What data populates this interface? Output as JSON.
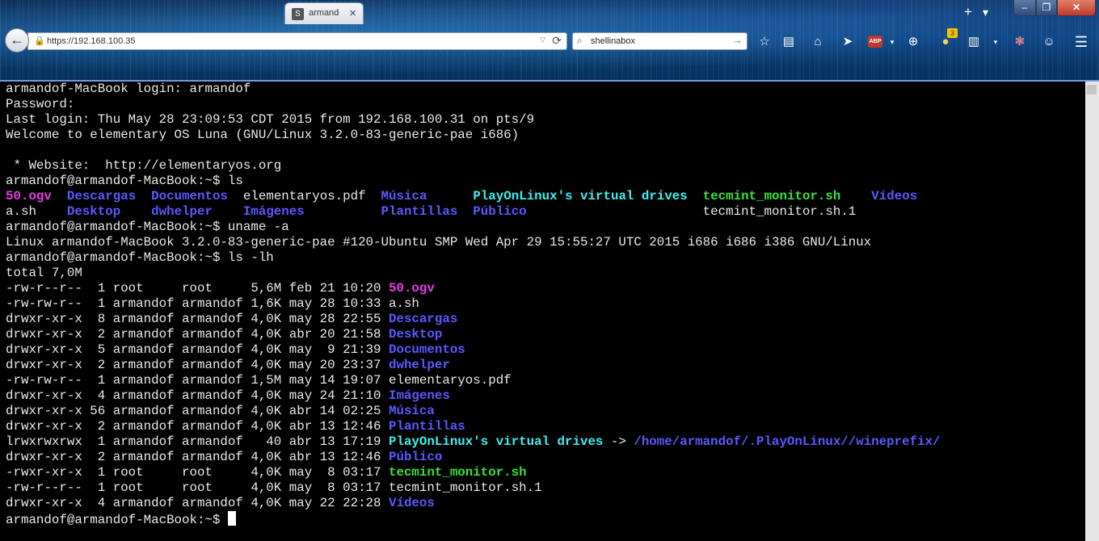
{
  "browser": {
    "tab_title": "armandof",
    "tab_close": "×",
    "new_tab": "+",
    "tab_list": "▾",
    "window_controls": {
      "minimize": "–",
      "maximize": "❐",
      "close": "✕"
    },
    "url": "https://192.168.100.35",
    "search": {
      "value": "shellinabox"
    },
    "toolbar_icons": [
      "bookmark-star-icon",
      "reading-list-icon",
      "home-icon",
      "send-icon",
      "adblock-icon",
      "globe-icon",
      "colorful-extension-icon",
      "clipboard-icon",
      "dropdown-icon",
      "cluster-icon",
      "smiley-icon",
      "menu-icon"
    ],
    "extension_badge": "3",
    "abp_label": "ABP"
  },
  "terminal": {
    "colors": {
      "magenta": "#e83ce8",
      "blue": "#5959ff",
      "cyan": "#3ef0f0",
      "green": "#35e43a",
      "text": "#e9e9e9"
    },
    "lines": [
      {
        "t": "armandof-MacBook login: armandof"
      },
      {
        "t": "Password:"
      },
      {
        "t": "Last login: Thu May 28 23:09:53 CDT 2015 from 192.168.100.31 on pts/9"
      },
      {
        "t": "Welcome to elementary OS Luna (GNU/Linux 3.2.0-83-generic-pae i686)"
      },
      {
        "t": ""
      },
      {
        "t": " * Website:  http://elementaryos.org"
      },
      {
        "t": "armandof@armandof-MacBook:~$ ls"
      },
      {
        "segs": [
          [
            "mag",
            "50.ogv"
          ],
          [
            "",
            "  "
          ],
          [
            "blue",
            "Descargas"
          ],
          [
            "",
            "  "
          ],
          [
            "blue",
            "Documentos"
          ],
          [
            "",
            "  elementaryos.pdf  "
          ],
          [
            "blue",
            "Música"
          ],
          [
            "",
            "      "
          ],
          [
            "cyan",
            "PlayOnLinux's virtual drives"
          ],
          [
            "",
            "  "
          ],
          [
            "green",
            "tecmint_monitor.sh"
          ],
          [
            "",
            "    "
          ],
          [
            "blue",
            "Vídeos"
          ]
        ]
      },
      {
        "segs": [
          [
            "",
            "a.sh    "
          ],
          [
            "blue",
            "Desktop"
          ],
          [
            "",
            "    "
          ],
          [
            "blue",
            "dwhelper"
          ],
          [
            "",
            "    "
          ],
          [
            "blue",
            "Imágenes"
          ],
          [
            "",
            "          "
          ],
          [
            "blue",
            "Plantillas"
          ],
          [
            "",
            "  "
          ],
          [
            "blue",
            "Público"
          ],
          [
            "",
            "                       tecmint_monitor.sh.1"
          ]
        ]
      },
      {
        "t": "armandof@armandof-MacBook:~$ uname -a"
      },
      {
        "t": "Linux armandof-MacBook 3.2.0-83-generic-pae #120-Ubuntu SMP Wed Apr 29 15:55:27 UTC 2015 i686 i686 i386 GNU/Linux"
      },
      {
        "t": "armandof@armandof-MacBook:~$ ls -lh"
      },
      {
        "t": "total 7,0M"
      },
      {
        "segs": [
          [
            "",
            "-rw-r--r--  1 root     root     5,6M feb 21 10:20 "
          ],
          [
            "mag",
            "50.ogv"
          ]
        ]
      },
      {
        "t": "-rw-rw-r--  1 armandof armandof 1,6K may 28 10:33 a.sh"
      },
      {
        "segs": [
          [
            "",
            "drwxr-xr-x  8 armandof armandof 4,0K may 28 22:55 "
          ],
          [
            "blue",
            "Descargas"
          ]
        ]
      },
      {
        "segs": [
          [
            "",
            "drwxr-xr-x  2 armandof armandof 4,0K abr 20 21:58 "
          ],
          [
            "blue",
            "Desktop"
          ]
        ]
      },
      {
        "segs": [
          [
            "",
            "drwxr-xr-x  5 armandof armandof 4,0K may  9 21:39 "
          ],
          [
            "blue",
            "Documentos"
          ]
        ]
      },
      {
        "segs": [
          [
            "",
            "drwxr-xr-x  2 armandof armandof 4,0K may 20 23:37 "
          ],
          [
            "blue",
            "dwhelper"
          ]
        ]
      },
      {
        "t": "-rw-rw-r--  1 armandof armandof 1,5M may 14 19:07 elementaryos.pdf"
      },
      {
        "segs": [
          [
            "",
            "drwxr-xr-x  4 armandof armandof 4,0K may 24 21:10 "
          ],
          [
            "blue",
            "Imágenes"
          ]
        ]
      },
      {
        "segs": [
          [
            "",
            "drwxr-xr-x 56 armandof armandof 4,0K abr 14 02:25 "
          ],
          [
            "blue",
            "Música"
          ]
        ]
      },
      {
        "segs": [
          [
            "",
            "drwxr-xr-x  2 armandof armandof 4,0K abr 13 12:46 "
          ],
          [
            "blue",
            "Plantillas"
          ]
        ]
      },
      {
        "segs": [
          [
            "",
            "lrwxrwxrwx  1 armandof armandof   40 abr 13 17:19 "
          ],
          [
            "cyan",
            "PlayOnLinux's virtual drives"
          ],
          [
            "",
            " -> "
          ],
          [
            "blue",
            "/home/armandof/.PlayOnLinux//wineprefix/"
          ]
        ]
      },
      {
        "segs": [
          [
            "",
            "drwxr-xr-x  2 armandof armandof 4,0K abr 13 12:46 "
          ],
          [
            "blue",
            "Público"
          ]
        ]
      },
      {
        "segs": [
          [
            "",
            "-rwxr-xr-x  1 root     root     4,0K may  8 03:17 "
          ],
          [
            "green",
            "tecmint_monitor.sh"
          ]
        ]
      },
      {
        "t": "-rw-r--r--  1 root     root     4,0K may  8 03:17 tecmint_monitor.sh.1"
      },
      {
        "segs": [
          [
            "",
            "drwxr-xr-x  4 armandof armandof 4,0K may 22 22:28 "
          ],
          [
            "blue",
            "Vídeos"
          ]
        ]
      }
    ],
    "prompt": "armandof@armandof-MacBook:~$ "
  }
}
